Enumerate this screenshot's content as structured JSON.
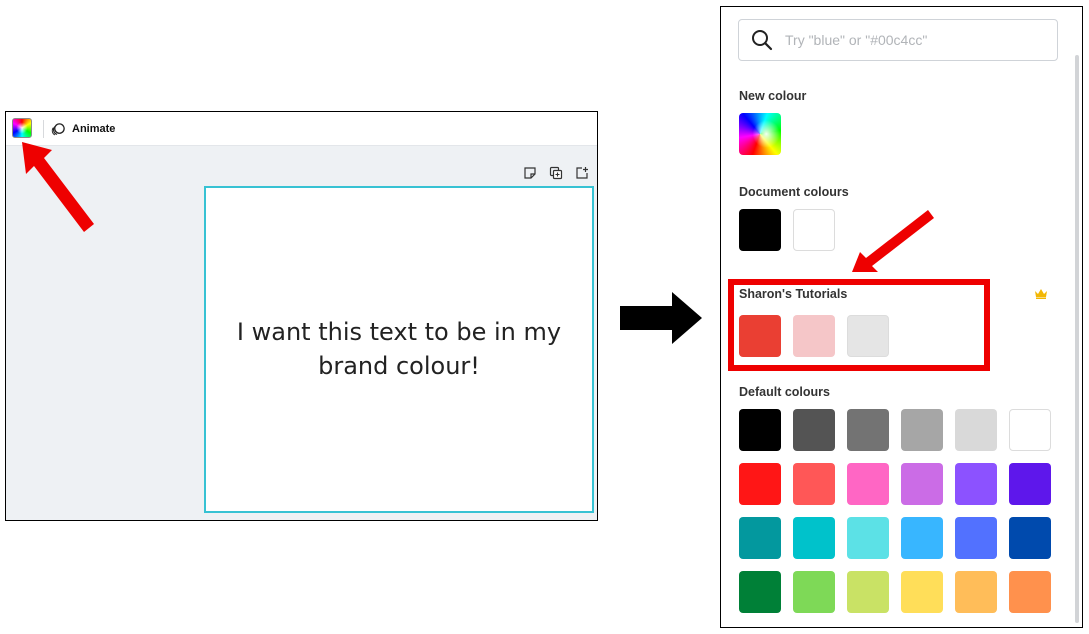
{
  "editor": {
    "animate_label": "Animate",
    "page_text": "I want this text to be in my brand colour!"
  },
  "panel": {
    "search_placeholder": "Try \"blue\" or \"#00c4cc\"",
    "new_colour_title": "New colour",
    "document_colours_title": "Document colours",
    "document_colours": [
      "#000000",
      "#ffffff"
    ],
    "brand_kit_title": "Sharon's Tutorials",
    "brand_colours": [
      "#ea3f33",
      "#f5c6c8",
      "#e5e5e5"
    ],
    "default_colours_title": "Default colours",
    "default_colours": [
      [
        "#000000",
        "#545454",
        "#737373",
        "#a6a6a6",
        "#d9d9d9",
        "#ffffff"
      ],
      [
        "#ff1616",
        "#ff5757",
        "#ff66c4",
        "#cb6ce6",
        "#8c52ff",
        "#5e17eb"
      ],
      [
        "#03989e",
        "#00c2cb",
        "#5ce1e6",
        "#38b6ff",
        "#5271ff",
        "#004aad"
      ],
      [
        "#008037",
        "#7ed957",
        "#c9e265",
        "#ffde59",
        "#ffbd59",
        "#ff914d"
      ]
    ]
  },
  "annotations": {
    "arrow_color": "#ee0000",
    "highlight_color": "#ee0000",
    "transition_arrow_color": "#000000"
  }
}
